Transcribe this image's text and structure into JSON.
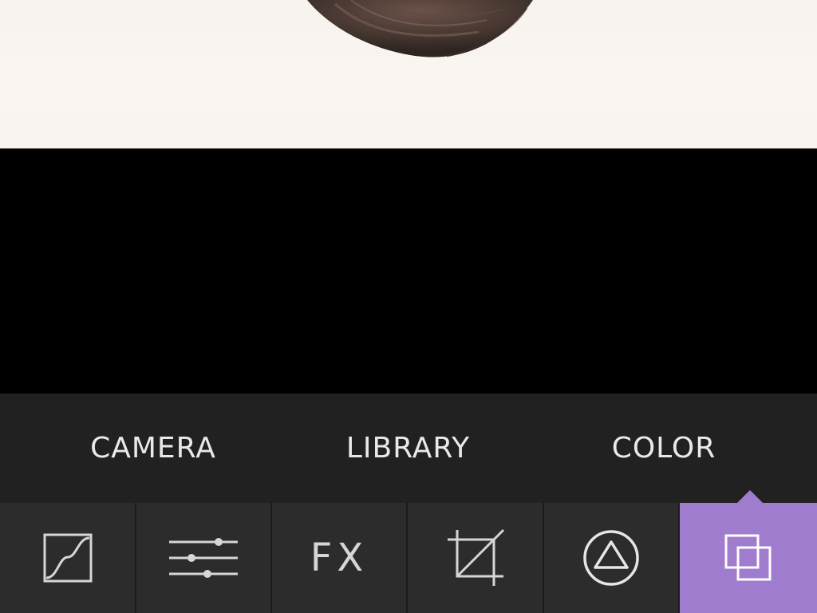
{
  "photo": {
    "subject": "hair-bun-photo"
  },
  "source_bar": {
    "items": [
      {
        "label": "CAMERA"
      },
      {
        "label": "LIBRARY"
      },
      {
        "label": "COLOR"
      }
    ]
  },
  "tool_bar": {
    "items": [
      {
        "icon": "curves-icon"
      },
      {
        "icon": "sliders-icon"
      },
      {
        "label": "FX",
        "icon": "fx-icon"
      },
      {
        "icon": "crop-icon"
      },
      {
        "icon": "triangle-circle-icon"
      },
      {
        "icon": "layers-icon",
        "active": true
      }
    ]
  },
  "colors": {
    "source_bar_bg": "#212121",
    "tool_bar_bg": "#2b2b2b",
    "active_accent": "#a07ccf",
    "text": "#e9e9e9"
  }
}
